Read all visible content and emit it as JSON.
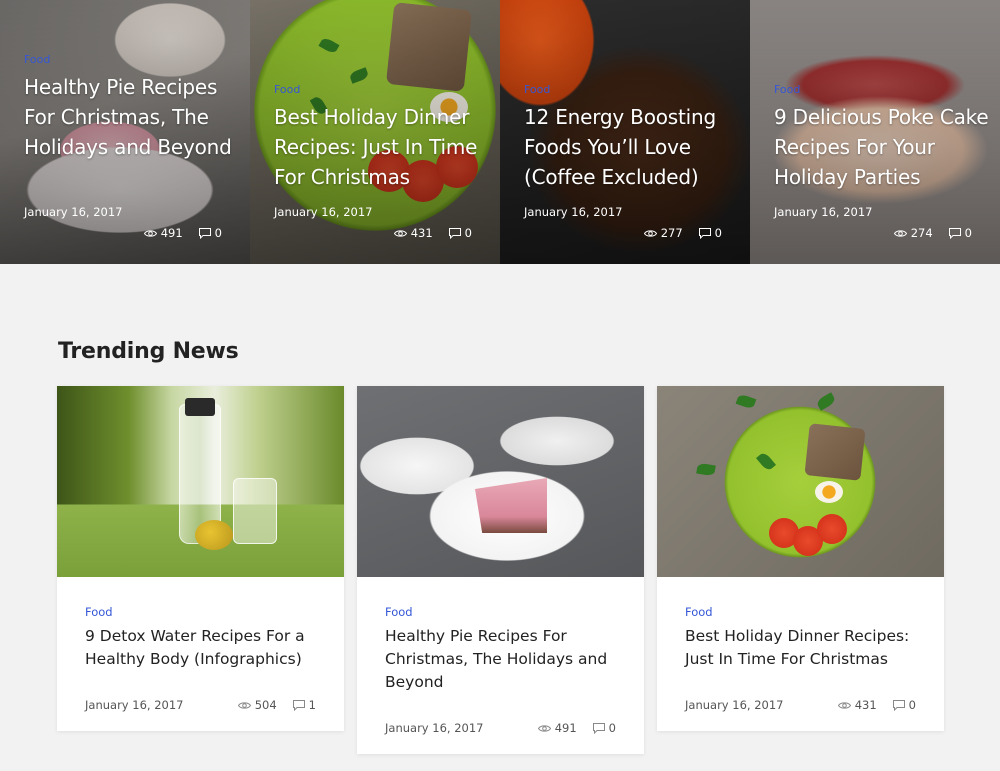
{
  "hero": [
    {
      "category": "Food",
      "title": "Healthy Pie Recipes For Christmas, The Holidays and Beyond",
      "date": "January 16, 2017",
      "views": "491",
      "comments": "0"
    },
    {
      "category": "Food",
      "title": "Best Holiday Dinner Recipes: Just In Time For Christmas",
      "date": "January 16, 2017",
      "views": "431",
      "comments": "0"
    },
    {
      "category": "Food",
      "title": "12 Energy Boosting Foods You’ll Love (Coffee Excluded)",
      "date": "January 16, 2017",
      "views": "277",
      "comments": "0"
    },
    {
      "category": "Food",
      "title": "9 Delicious Poke Cake Recipes For Your Holiday Parties",
      "date": "January 16, 2017",
      "views": "274",
      "comments": "0"
    }
  ],
  "trending": {
    "heading": "Trending News",
    "cards": [
      {
        "category": "Food",
        "title": "9 Detox Water Recipes For a Healthy Body (Infographics)",
        "date": "January 16, 2017",
        "views": "504",
        "comments": "1"
      },
      {
        "category": "Food",
        "title": "Healthy Pie Recipes For Christmas, The Holidays and Beyond",
        "date": "January 16, 2017",
        "views": "491",
        "comments": "0"
      },
      {
        "category": "Food",
        "title": "Best Holiday Dinner Recipes: Just In Time For Christmas",
        "date": "January 16, 2017",
        "views": "431",
        "comments": "0"
      }
    ]
  },
  "colors": {
    "category": "#3557d6",
    "background": "#f2f2f2",
    "card": "#ffffff"
  },
  "icons": {
    "views": "eye-icon",
    "comments": "comment-icon"
  }
}
